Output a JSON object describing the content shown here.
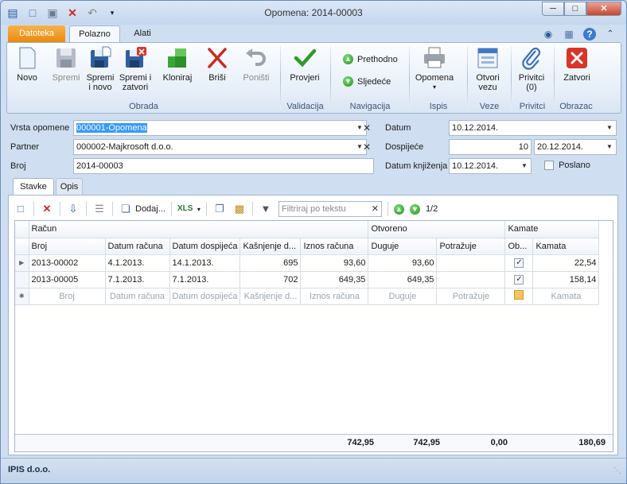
{
  "window": {
    "title": "Opomena: 2014-00003"
  },
  "ribbon_tabs": [
    {
      "label": "Datoteka"
    },
    {
      "label": "Polazno"
    },
    {
      "label": "Alati"
    }
  ],
  "ribbon": {
    "novo": "Novo",
    "spremi": "Spremi",
    "spremi_novo": [
      "Spremi",
      "i novo"
    ],
    "spremi_zatvori": [
      "Spremi i",
      "zatvori"
    ],
    "kloniraj": "Kloniraj",
    "brisi": "Briši",
    "ponisti": "Poništi",
    "provjeri": "Provjeri",
    "prethodno": "Prethodno",
    "sljedece": "Sljedeće",
    "opomena": "Opomena",
    "otvori_vezu": [
      "Otvori",
      "vezu"
    ],
    "privitci": [
      "Privitci",
      "(0)"
    ],
    "zatvori": "Zatvori",
    "groups": {
      "obrada": "Obrada",
      "validacija": "Validacija",
      "navigacija": "Navigacija",
      "ispis": "Ispis",
      "veze": "Veze",
      "privitci": "Privitci",
      "obrazac": "Obrazac"
    }
  },
  "form": {
    "vrsta_label": "Vrsta opomene",
    "vrsta_value": "000001-Opomena",
    "partner_label": "Partner",
    "partner_value": "000002-Majkrosoft d.o.o.",
    "broj_label": "Broj",
    "broj_value": "2014-00003",
    "datum_label": "Datum",
    "datum_value": "10.12.2014.",
    "dospijece_label": "Dospijeće",
    "dospijece_days": "10",
    "dospijece_date": "20.12.2014.",
    "datum_knjizenja_label": "Datum knjiženja",
    "datum_knjizenja_value": "10.12.2014.",
    "poslano_label": "Poslano"
  },
  "inner_tabs": [
    {
      "label": "Stavke"
    },
    {
      "label": "Opis"
    }
  ],
  "grid_toolbar": {
    "dodaj": "Dodaj...",
    "filter_placeholder": "Filtriraj po tekstu",
    "page": "1/2"
  },
  "grid": {
    "group_headers": {
      "racun": "Račun",
      "otvoreno": "Otvoreno",
      "kamate": "Kamate"
    },
    "columns": {
      "broj": "Broj",
      "datum_racuna": "Datum računa",
      "datum_dospijeca": "Datum dospijeća",
      "kasnjenje": "Kašnjenje d...",
      "iznos": "Iznos računa",
      "duguje": "Duguje",
      "potrazuje": "Potražuje",
      "ob": "Ob...",
      "kamata": "Kamata"
    },
    "rows": [
      {
        "broj": "2013-00002",
        "datum_racuna": "4.1.2013.",
        "datum_dospijeca": "14.1.2013.",
        "kasnjenje": "695",
        "iznos": "93,60",
        "duguje": "93,60",
        "potrazuje": "",
        "kamata": "22,54"
      },
      {
        "broj": "2013-00005",
        "datum_racuna": "7.1.2013.",
        "datum_dospijeca": "7.1.2013.",
        "kasnjenje": "702",
        "iznos": "649,35",
        "duguje": "649,35",
        "potrazuje": "",
        "kamata": "158,14"
      }
    ],
    "new_row": {
      "broj": "Broj",
      "datum_racuna": "Datum računa",
      "datum_dospijeca": "Datum dospijeća",
      "kasnjenje": "Kašnjenje d...",
      "iznos": "Iznos računa",
      "duguje": "Duguje",
      "potrazuje": "Potražuje",
      "kamata": "Kamata"
    },
    "totals": {
      "iznos": "742,95",
      "duguje": "742,95",
      "potrazuje": "0,00",
      "kamata": "180,69"
    }
  },
  "status": {
    "company": "IPIS d.o.o."
  }
}
